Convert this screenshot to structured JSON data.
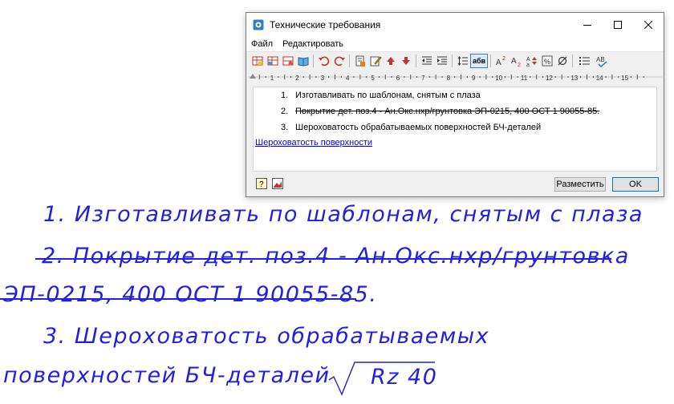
{
  "window": {
    "title": "Технические требования",
    "icon": "app-icon",
    "controls": [
      "minimize-icon",
      "maximize-icon",
      "close-icon"
    ]
  },
  "menu": {
    "file": "Файл",
    "edit": "Редактировать"
  },
  "toolbar": {
    "icons": [
      "insert-table-icon",
      "insert-table2-icon",
      "insert-row-icon",
      "book-icon",
      "undo-icon",
      "redo-icon",
      "paste-icon",
      "edit-icon",
      "move-up-icon",
      "move-down-icon",
      "indent-decrease-icon",
      "indent-increase-icon",
      "line-spacing-icon",
      "text-format-icon",
      "superscript-icon",
      "subscript-icon",
      "case-icon",
      "symbol-icon",
      "diameter-icon",
      "list-icon",
      "spellcheck-icon"
    ],
    "active_label": "абв"
  },
  "ruler": {
    "ticks": [
      "1",
      "2",
      "3",
      "4",
      "5",
      "6",
      "7",
      "8",
      "9",
      "10",
      "11",
      "12",
      "13",
      "14",
      "15"
    ]
  },
  "editor": {
    "items": [
      {
        "num": "1.",
        "text": "Изготавливать по шаблонам, снятым с плаза"
      },
      {
        "num": "2.",
        "text": "Покрытие дет. поз.4 - Ан.Окс.нхр/грунтовка ЭП-0215, 400 ОСТ 1 90055-85."
      },
      {
        "num": "3.",
        "text": "Шероховатость обрабатываемых поверхностей БЧ-деталей"
      }
    ],
    "link": "Шероховатость поверхности"
  },
  "buttons": {
    "place": "Разместить",
    "ok": "OK"
  },
  "drawing": {
    "line1": "1.  Изготавливать по шаблонам, снятым с плаза",
    "line2a": "2. Покрытие дет. поз.4  - Ан.Окс.нхр/грунтовка",
    "line2b": "ЭП-0215, 400 ОСТ 1 90055-85.",
    "line3a": "3.  Шероховатость обрабатываемых",
    "line3b": "поверхностей БЧ-деталей",
    "roughness": "Rz 40"
  },
  "colors": {
    "drawing_ink": "#2020e0",
    "link": "#0000ee"
  }
}
